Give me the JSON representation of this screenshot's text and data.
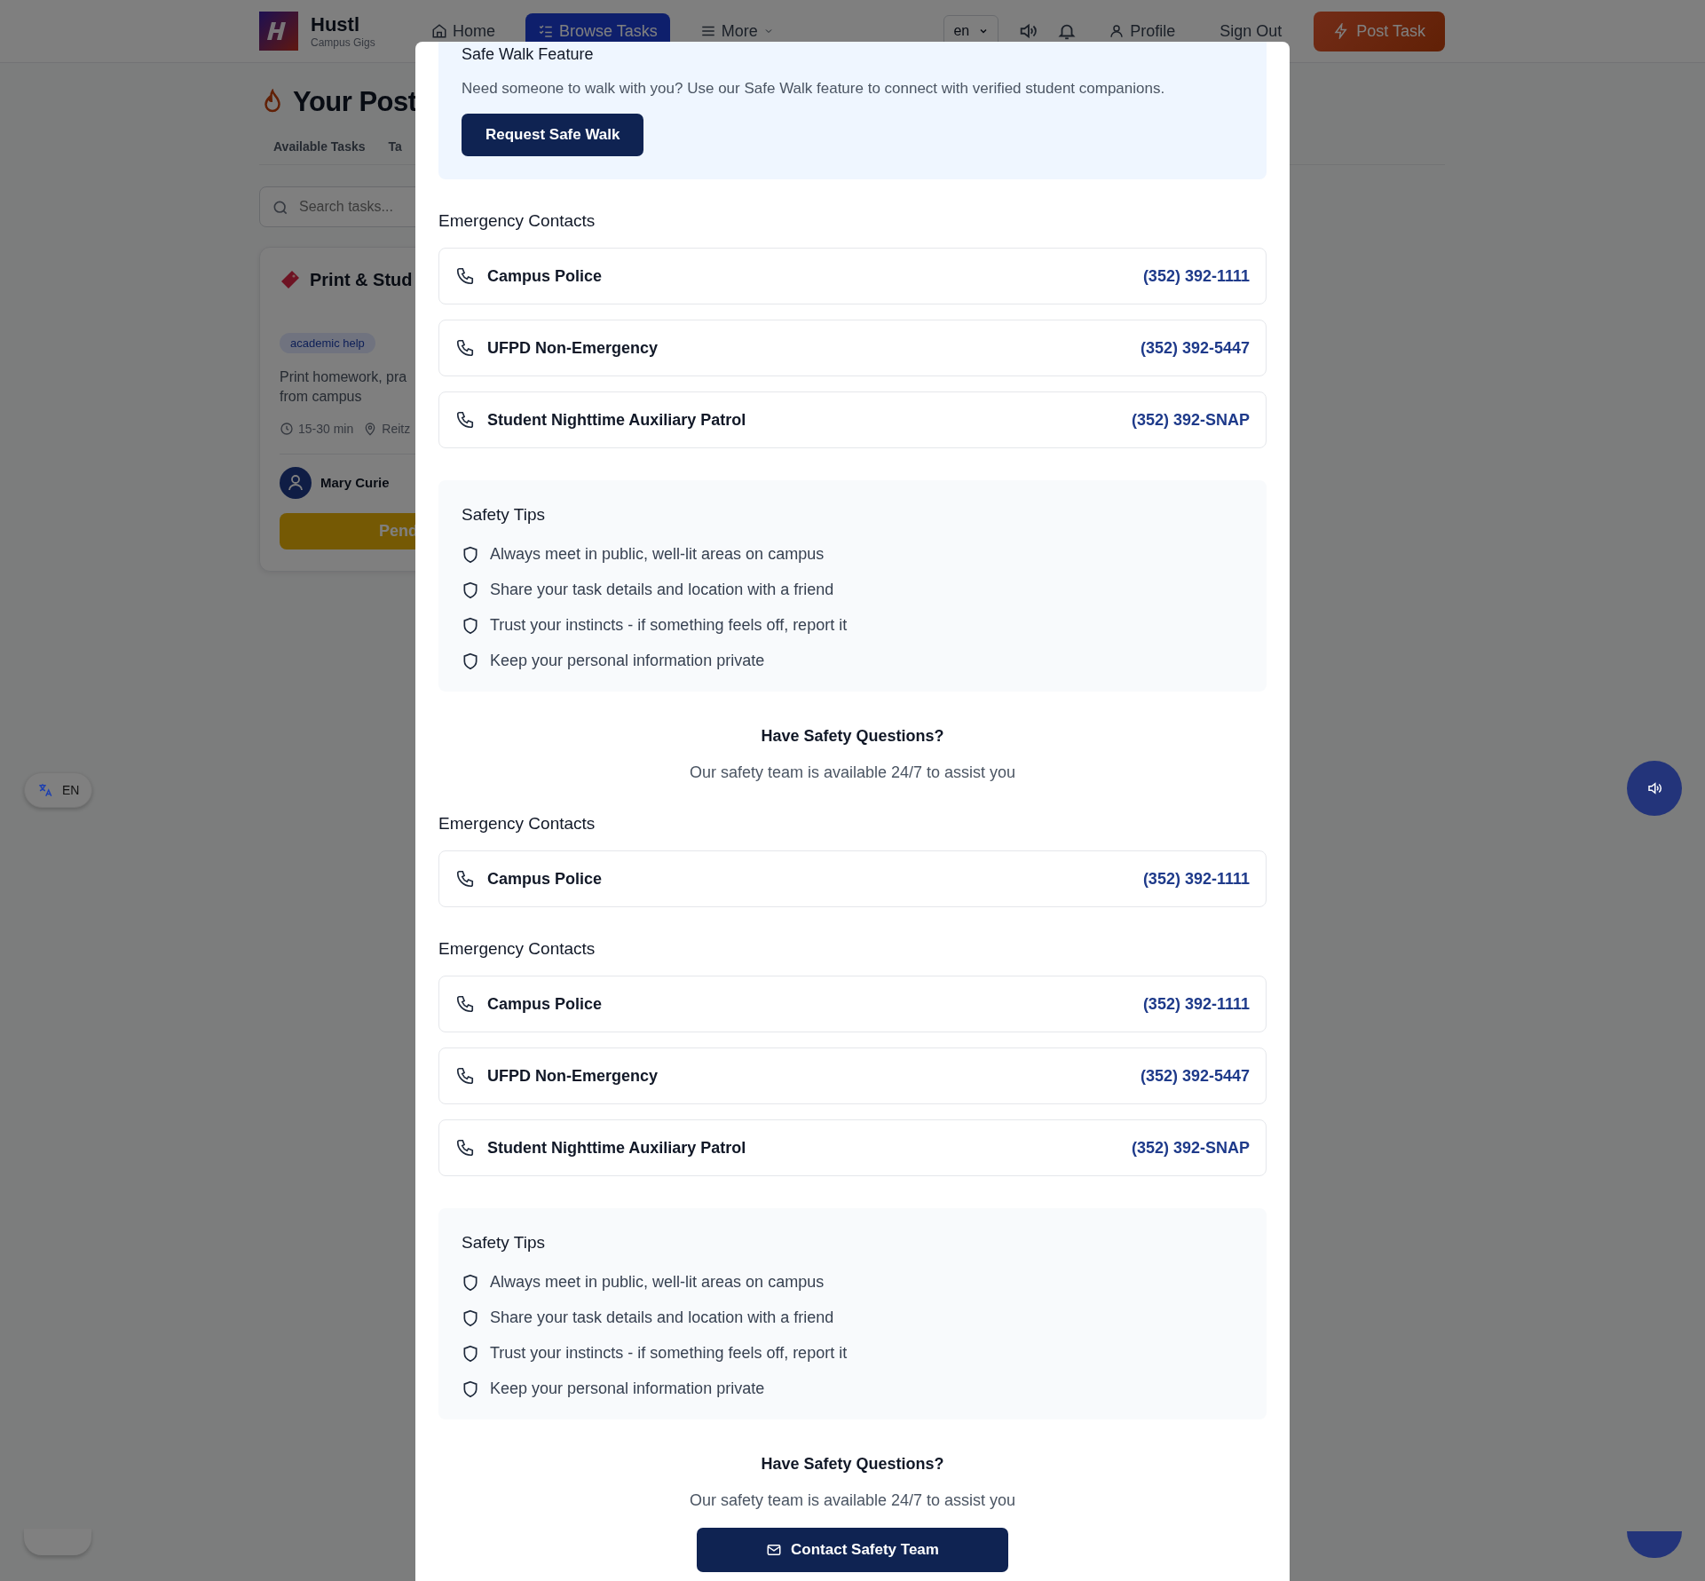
{
  "header": {
    "logo": {
      "name": "Hustl",
      "tagline": "Campus Gigs"
    },
    "nav": [
      {
        "label": "Home",
        "selected": false
      },
      {
        "label": "Browse Tasks",
        "selected": true
      },
      {
        "label": "More",
        "selected": false
      }
    ],
    "language": "en",
    "profile": "Profile",
    "sign_out": "Sign Out",
    "post_task": "Post Task"
  },
  "page": {
    "title": "Your Post",
    "tabs": [
      {
        "label": "Available Tasks",
        "selected": false
      },
      {
        "label": "Ta",
        "selected": false
      }
    ],
    "search": {
      "placeholder": "Search tasks..."
    },
    "card": {
      "title": "Print & Stud",
      "tag": "academic help",
      "description_lines": [
        "Print homework, pra",
        "from campus"
      ],
      "duration": "15-30 min",
      "location": "Reitz",
      "poster": "Mary Curie",
      "status": "Pend"
    }
  },
  "language_button": {
    "label": "EN"
  },
  "modal": {
    "sections": [
      {
        "kind": "safe_walk",
        "title": "Safe Walk Feature",
        "text": "Need someone to walk with you? Use our Safe Walk feature to connect with verified student companions.",
        "button": "Request Safe Walk"
      },
      {
        "kind": "contacts",
        "title": "Emergency Contacts",
        "items": [
          {
            "name": "Campus Police",
            "phone": "(352) 392-1111"
          },
          {
            "name": "UFPD Non-Emergency",
            "phone": "(352) 392-5447"
          },
          {
            "name": "Student Nighttime Auxiliary Patrol",
            "phone": "(352) 392-SNAP"
          }
        ]
      },
      {
        "kind": "tips",
        "title": "Safety Tips",
        "items": [
          "Always meet in public, well-lit areas on campus",
          "Share your task details and location with a friend",
          "Trust your instincts - if something feels off, report it",
          "Keep your personal information private"
        ]
      },
      {
        "kind": "questions",
        "title": "Have Safety Questions?",
        "text": "Our safety team is available 24/7 to assist you"
      },
      {
        "kind": "contacts",
        "title": "Emergency Contacts",
        "items": [
          {
            "name": "Campus Police",
            "phone": "(352) 392-1111"
          }
        ]
      },
      {
        "kind": "contacts",
        "title": "Emergency Contacts",
        "items": [
          {
            "name": "Campus Police",
            "phone": "(352) 392-1111"
          },
          {
            "name": "UFPD Non-Emergency",
            "phone": "(352) 392-5447"
          },
          {
            "name": "Student Nighttime Auxiliary Patrol",
            "phone": "(352) 392-SNAP"
          }
        ]
      },
      {
        "kind": "tips",
        "title": "Safety Tips",
        "items": [
          "Always meet in public, well-lit areas on campus",
          "Share your task details and location with a friend",
          "Trust your instincts - if something feels off, report it",
          "Keep your personal information private"
        ]
      },
      {
        "kind": "questions",
        "title": "Have Safety Questions?",
        "text": "Our safety team is available 24/7 to assist you",
        "button": "Contact Safety Team"
      }
    ]
  }
}
